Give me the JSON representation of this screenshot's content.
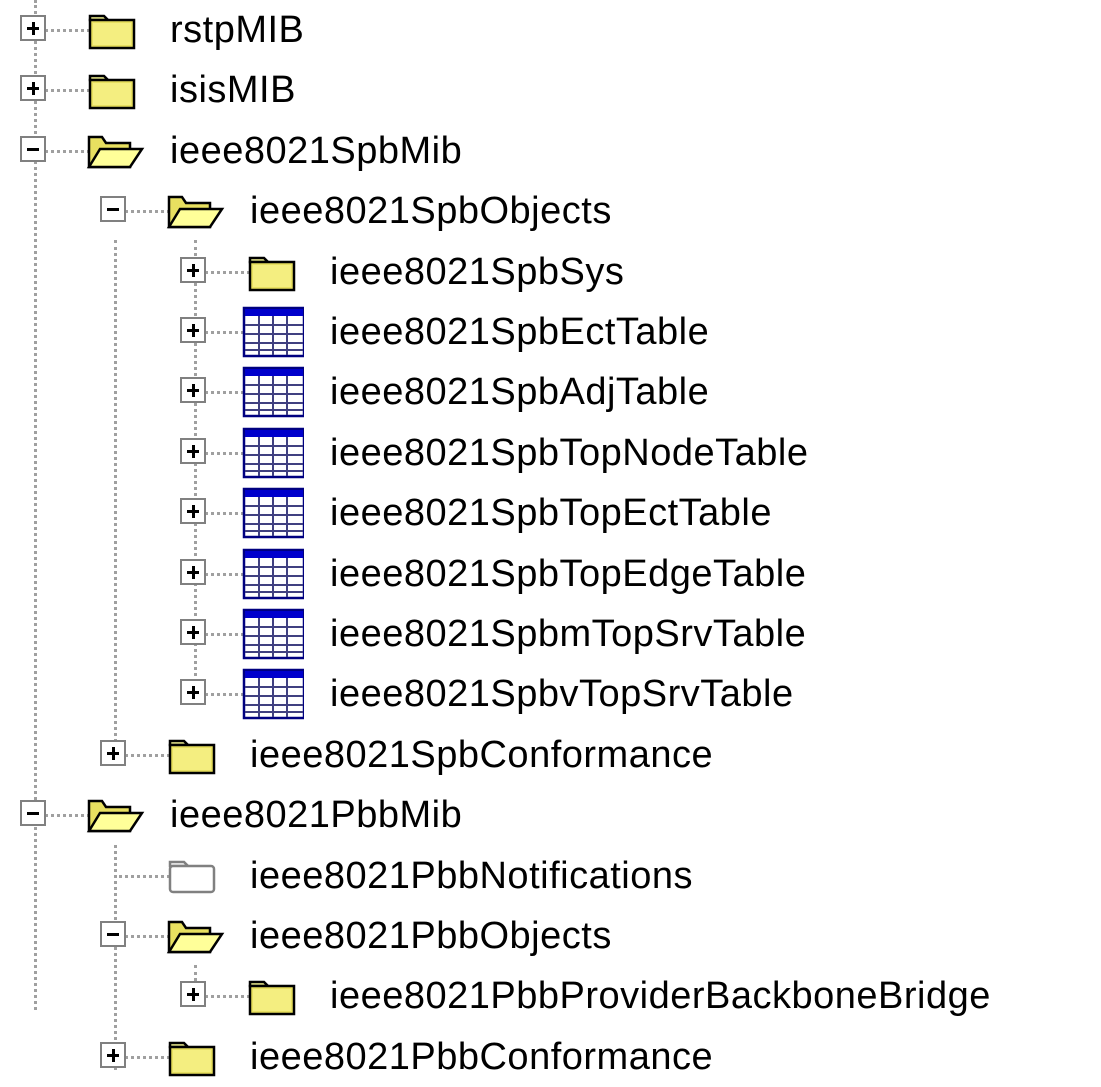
{
  "tree": {
    "nodes": [
      {
        "label": "rstpMIB",
        "expander": "plus",
        "icon": "folder-closed"
      },
      {
        "label": "isisMIB",
        "expander": "plus",
        "icon": "folder-closed"
      },
      {
        "label": "ieee8021SpbMib",
        "expander": "minus",
        "icon": "folder-open"
      },
      {
        "label": "ieee8021SpbObjects",
        "expander": "minus",
        "icon": "folder-open"
      },
      {
        "label": "ieee8021SpbSys",
        "expander": "plus",
        "icon": "folder-closed"
      },
      {
        "label": "ieee8021SpbEctTable",
        "expander": "plus",
        "icon": "table"
      },
      {
        "label": "ieee8021SpbAdjTable",
        "expander": "plus",
        "icon": "table"
      },
      {
        "label": "ieee8021SpbTopNodeTable",
        "expander": "plus",
        "icon": "table"
      },
      {
        "label": "ieee8021SpbTopEctTable",
        "expander": "plus",
        "icon": "table"
      },
      {
        "label": "ieee8021SpbTopEdgeTable",
        "expander": "plus",
        "icon": "table"
      },
      {
        "label": "ieee8021SpbmTopSrvTable",
        "expander": "plus",
        "icon": "table"
      },
      {
        "label": "ieee8021SpbvTopSrvTable",
        "expander": "plus",
        "icon": "table"
      },
      {
        "label": "ieee8021SpbConformance",
        "expander": "plus",
        "icon": "folder-closed"
      },
      {
        "label": "ieee8021PbbMib",
        "expander": "minus",
        "icon": "folder-open"
      },
      {
        "label": "ieee8021PbbNotifications",
        "expander": "none",
        "icon": "folder-empty"
      },
      {
        "label": "ieee8021PbbObjects",
        "expander": "minus",
        "icon": "folder-open"
      },
      {
        "label": "ieee8021PbbProviderBackboneBridge",
        "expander": "plus",
        "icon": "folder-closed"
      },
      {
        "label": "ieee8021PbbConformance",
        "expander": "plus",
        "icon": "folder-closed"
      }
    ]
  }
}
